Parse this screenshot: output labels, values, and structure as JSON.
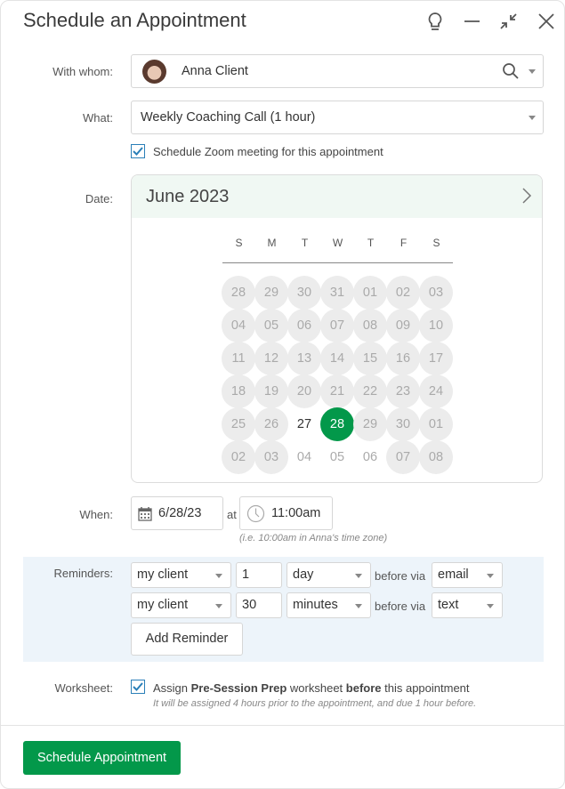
{
  "dialog": {
    "title": "Schedule an Appointment",
    "header_icons": [
      "lightbulb-icon",
      "minimize-icon",
      "collapse-icon",
      "close-icon"
    ]
  },
  "form": {
    "with_whom": {
      "label": "With whom:",
      "value": "Anna Client",
      "avatar": "client-avatar"
    },
    "what": {
      "label": "What:",
      "value": "Weekly Coaching Call (1 hour)"
    },
    "zoom": {
      "checked": true,
      "label": "Schedule Zoom meeting for this appointment"
    },
    "date": {
      "label": "Date:"
    },
    "when": {
      "label": "When:",
      "date": "6/28/23",
      "at": "at",
      "time": "11:00am",
      "hint": "(i.e. 10:00am in Anna's time zone)"
    },
    "reminders": {
      "label": "Reminders:",
      "rows": [
        {
          "recipient": "my client",
          "amount": "1",
          "unit": "day",
          "before_via": "before via",
          "channel": "email"
        },
        {
          "recipient": "my client",
          "amount": "30",
          "unit": "minutes",
          "before_via": "before via",
          "channel": "text"
        }
      ],
      "add_label": "Add Reminder"
    },
    "worksheet": {
      "label": "Worksheet:",
      "checked": true,
      "text_prefix": "Assign ",
      "worksheet_name": "Pre-Session Prep",
      "text_middle": " worksheet ",
      "timing": "before",
      "text_suffix": " this appointment",
      "hint": "It will be assigned 4 hours prior to the appointment, and due 1 hour before."
    }
  },
  "calendar": {
    "month": "June 2023",
    "weekdays": [
      "S",
      "M",
      "T",
      "W",
      "T",
      "F",
      "S"
    ],
    "weeks": [
      [
        {
          "d": "28",
          "s": "disabled"
        },
        {
          "d": "29",
          "s": "disabled"
        },
        {
          "d": "30",
          "s": "disabled"
        },
        {
          "d": "31",
          "s": "disabled"
        },
        {
          "d": "01",
          "s": "disabled"
        },
        {
          "d": "02",
          "s": "disabled"
        },
        {
          "d": "03",
          "s": "disabled"
        }
      ],
      [
        {
          "d": "04",
          "s": "disabled"
        },
        {
          "d": "05",
          "s": "disabled"
        },
        {
          "d": "06",
          "s": "disabled"
        },
        {
          "d": "07",
          "s": "disabled"
        },
        {
          "d": "08",
          "s": "disabled"
        },
        {
          "d": "09",
          "s": "disabled"
        },
        {
          "d": "10",
          "s": "disabled"
        }
      ],
      [
        {
          "d": "11",
          "s": "disabled"
        },
        {
          "d": "12",
          "s": "disabled"
        },
        {
          "d": "13",
          "s": "disabled"
        },
        {
          "d": "14",
          "s": "disabled"
        },
        {
          "d": "15",
          "s": "disabled"
        },
        {
          "d": "16",
          "s": "disabled"
        },
        {
          "d": "17",
          "s": "disabled"
        }
      ],
      [
        {
          "d": "18",
          "s": "disabled"
        },
        {
          "d": "19",
          "s": "disabled"
        },
        {
          "d": "20",
          "s": "disabled"
        },
        {
          "d": "21",
          "s": "disabled"
        },
        {
          "d": "22",
          "s": "disabled"
        },
        {
          "d": "23",
          "s": "disabled"
        },
        {
          "d": "24",
          "s": "disabled"
        }
      ],
      [
        {
          "d": "25",
          "s": "disabled"
        },
        {
          "d": "26",
          "s": "disabled"
        },
        {
          "d": "27",
          "s": "avail"
        },
        {
          "d": "28",
          "s": "selected"
        },
        {
          "d": "29",
          "s": "disabled"
        },
        {
          "d": "30",
          "s": "disabled"
        },
        {
          "d": "01",
          "s": "disabled"
        }
      ],
      [
        {
          "d": "02",
          "s": "disabled"
        },
        {
          "d": "03",
          "s": "disabled"
        },
        {
          "d": "04",
          "s": "future"
        },
        {
          "d": "05",
          "s": "future"
        },
        {
          "d": "06",
          "s": "future"
        },
        {
          "d": "07",
          "s": "disabled"
        },
        {
          "d": "08",
          "s": "disabled"
        }
      ]
    ]
  },
  "footer": {
    "submit_label": "Schedule Appointment"
  },
  "colors": {
    "primary": "#03984a",
    "calendar_header_bg": "#f0f8f3",
    "reminders_bg": "#edf4fa",
    "checkbox": "#2a7fb8"
  }
}
